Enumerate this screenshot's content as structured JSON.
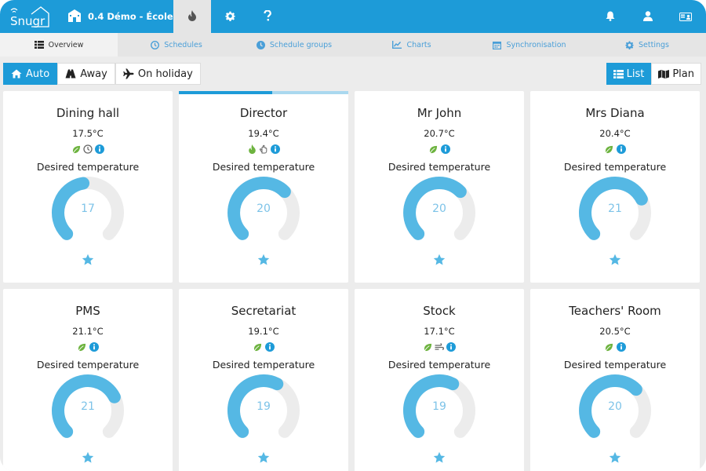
{
  "app": {
    "logo_text": "Snugr",
    "site_name": "0.4 Démo - École"
  },
  "topbar": {
    "icons": [
      "house-icon",
      "flame-icon",
      "gear-icon",
      "question-icon",
      "bell-icon",
      "user-icon",
      "id-card-icon"
    ]
  },
  "tabs": [
    {
      "label": "Overview",
      "icon": "list-icon",
      "active": true
    },
    {
      "label": "Schedules",
      "icon": "clock-icon",
      "active": false
    },
    {
      "label": "Schedule groups",
      "icon": "clock-icon",
      "active": false
    },
    {
      "label": "Charts",
      "icon": "chart-icon",
      "active": false
    },
    {
      "label": "Synchronisation",
      "icon": "calendar-icon",
      "active": false
    },
    {
      "label": "Settings",
      "icon": "gear-icon",
      "active": false
    }
  ],
  "modes": [
    {
      "label": "Auto",
      "icon": "house-icon",
      "active": true
    },
    {
      "label": "Away",
      "icon": "road-icon",
      "active": false
    },
    {
      "label": "On holiday",
      "icon": "plane-icon",
      "active": false
    }
  ],
  "views": [
    {
      "label": "List",
      "icon": "list-icon",
      "active": true
    },
    {
      "label": "Plan",
      "icon": "map-icon",
      "active": false
    }
  ],
  "desired_label": "Desired temperature",
  "gauge_range": {
    "min": 10,
    "max": 25
  },
  "colors": {
    "brand": "#1d9bd8",
    "gauge_fill": "#55b8e4",
    "gauge_track": "#ececec",
    "leaf": "#6db33f",
    "flame": "#6db33f",
    "info": "#1d9bd8",
    "star": "#55b8e4"
  },
  "rooms": [
    {
      "name": "Dining hall",
      "temperature": "17.5°C",
      "desired": 17,
      "status_icons": [
        "leaf-icon",
        "clock-icon",
        "info-icon"
      ],
      "selected": false
    },
    {
      "name": "Director",
      "temperature": "19.4°C",
      "desired": 20,
      "status_icons": [
        "flame-icon",
        "hand-icon",
        "info-icon"
      ],
      "selected": true
    },
    {
      "name": "Mr John",
      "temperature": "20.7°C",
      "desired": 20,
      "status_icons": [
        "leaf-icon",
        "info-icon"
      ],
      "selected": false
    },
    {
      "name": "Mrs Diana",
      "temperature": "20.4°C",
      "desired": 21,
      "status_icons": [
        "leaf-icon",
        "info-icon"
      ],
      "selected": false
    },
    {
      "name": "PMS",
      "temperature": "21.1°C",
      "desired": 21,
      "status_icons": [
        "leaf-icon",
        "info-icon"
      ],
      "selected": false
    },
    {
      "name": "Secretariat",
      "temperature": "19.1°C",
      "desired": 19,
      "status_icons": [
        "leaf-icon",
        "info-icon"
      ],
      "selected": false
    },
    {
      "name": "Stock",
      "temperature": "17.1°C",
      "desired": 19,
      "status_icons": [
        "leaf-icon",
        "wind-icon",
        "info-icon"
      ],
      "selected": false
    },
    {
      "name": "Teachers' Room",
      "temperature": "20.5°C",
      "desired": 20,
      "status_icons": [
        "leaf-icon",
        "info-icon"
      ],
      "selected": false
    }
  ]
}
